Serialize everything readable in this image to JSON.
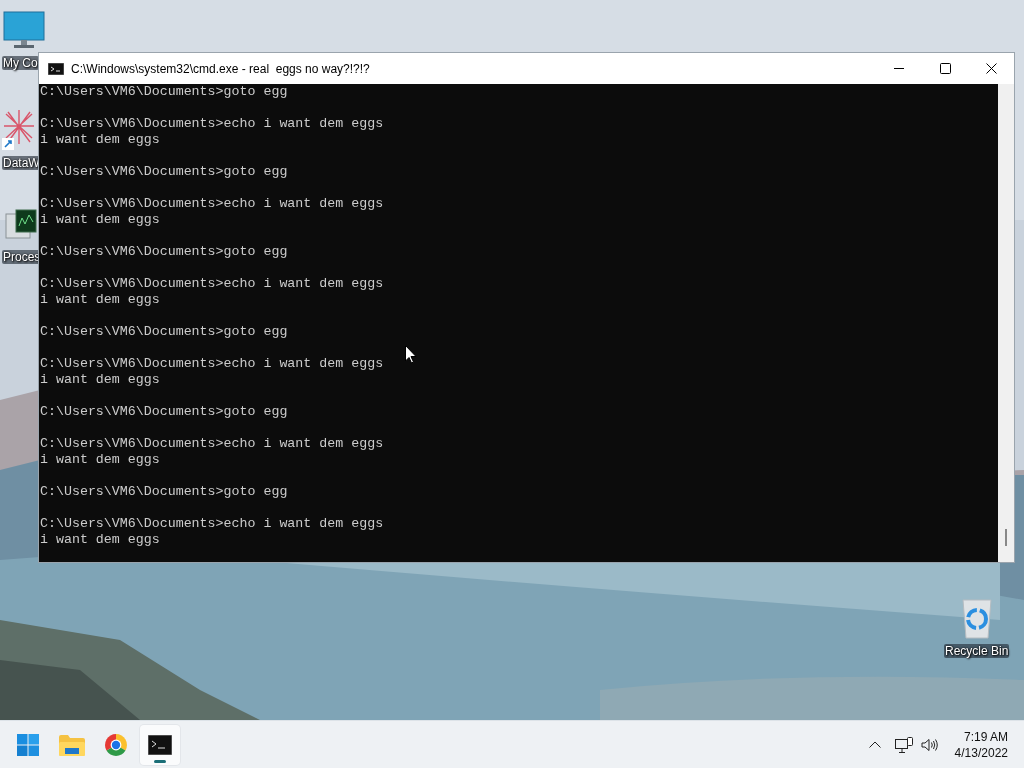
{
  "desktop": {
    "icons": [
      {
        "kind": "monitor",
        "label": "My Co"
      },
      {
        "kind": "network",
        "label": "DataW"
      },
      {
        "kind": "process",
        "label": "Proces"
      },
      {
        "kind": "recycle",
        "label": "Recycle Bin"
      }
    ]
  },
  "window": {
    "title": "C:\\Windows\\system32\\cmd.exe - real  eggs no way?!?!?",
    "console": {
      "blocks": [
        [
          "C:\\Users\\VM6\\Documents>goto egg"
        ],
        [
          "C:\\Users\\VM6\\Documents>echo i want dem eggs",
          "i want dem eggs"
        ],
        [
          "C:\\Users\\VM6\\Documents>goto egg"
        ],
        [
          "C:\\Users\\VM6\\Documents>echo i want dem eggs",
          "i want dem eggs"
        ],
        [
          "C:\\Users\\VM6\\Documents>goto egg"
        ],
        [
          "C:\\Users\\VM6\\Documents>echo i want dem eggs",
          "i want dem eggs"
        ],
        [
          "C:\\Users\\VM6\\Documents>goto egg"
        ],
        [
          "C:\\Users\\VM6\\Documents>echo i want dem eggs",
          "i want dem eggs"
        ],
        [
          "C:\\Users\\VM6\\Documents>goto egg"
        ],
        [
          "C:\\Users\\VM6\\Documents>echo i want dem eggs",
          "i want dem eggs"
        ],
        [
          "C:\\Users\\VM6\\Documents>goto egg"
        ],
        [
          "C:\\Users\\VM6\\Documents>echo i want dem eggs",
          "i want dem eggs"
        ]
      ]
    }
  },
  "taskbar": {
    "apps": [
      {
        "kind": "start",
        "selected": false
      },
      {
        "kind": "folder",
        "selected": false
      },
      {
        "kind": "browser",
        "selected": false
      },
      {
        "kind": "terminal",
        "selected": true
      }
    ],
    "tray": {
      "time": "7:19 AM",
      "date": "4/13/2022"
    }
  }
}
